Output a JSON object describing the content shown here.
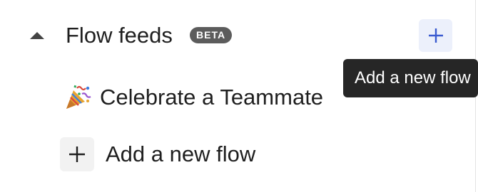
{
  "section": {
    "title": "Flow feeds",
    "badge": "BETA",
    "collapse_icon": "caret-up-icon",
    "add_button_icon": "plus-icon"
  },
  "tooltip": {
    "text": "Add a new flow"
  },
  "flows": [
    {
      "label": "Celebrate a Teammate",
      "icon": "party-popper-icon"
    }
  ],
  "add_flow": {
    "label": "Add a new flow",
    "icon": "plus-icon"
  },
  "colors": {
    "accent": "#3a5bd0",
    "add_button_bg": "#ecf0fb",
    "badge_bg": "#5c5c5c",
    "tooltip_bg": "#262626",
    "row_icon_bg": "#f2f2f2"
  }
}
